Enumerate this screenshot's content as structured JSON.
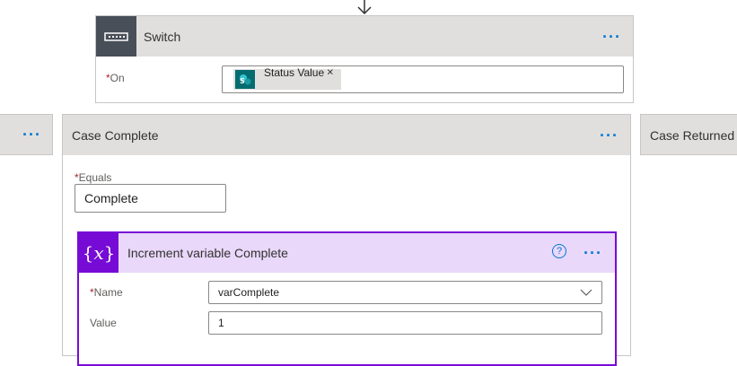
{
  "switch": {
    "title": "Switch",
    "on_label": "On",
    "token_label": "Status Value",
    "token_remove": "×"
  },
  "case_left": {},
  "case_complete": {
    "title": "Case Complete",
    "equals_label": "Equals",
    "equals_value": "Complete"
  },
  "case_returned": {
    "title": "Case Returned f"
  },
  "increment": {
    "title": "Increment variable Complete",
    "name_label": "Name",
    "name_value": "varComplete",
    "value_label": "Value",
    "value_value": "1"
  },
  "required_marker": "*",
  "more_glyph": "···",
  "colors": {
    "header_gray": "#e1dfdd",
    "switch_icon_bg": "#484f58",
    "variable_purple": "#770bd6",
    "variable_header": "#ead8fa",
    "sharepoint_teal": "#036c70",
    "accent_blue": "#0078d4",
    "required_red": "#a4262c"
  }
}
